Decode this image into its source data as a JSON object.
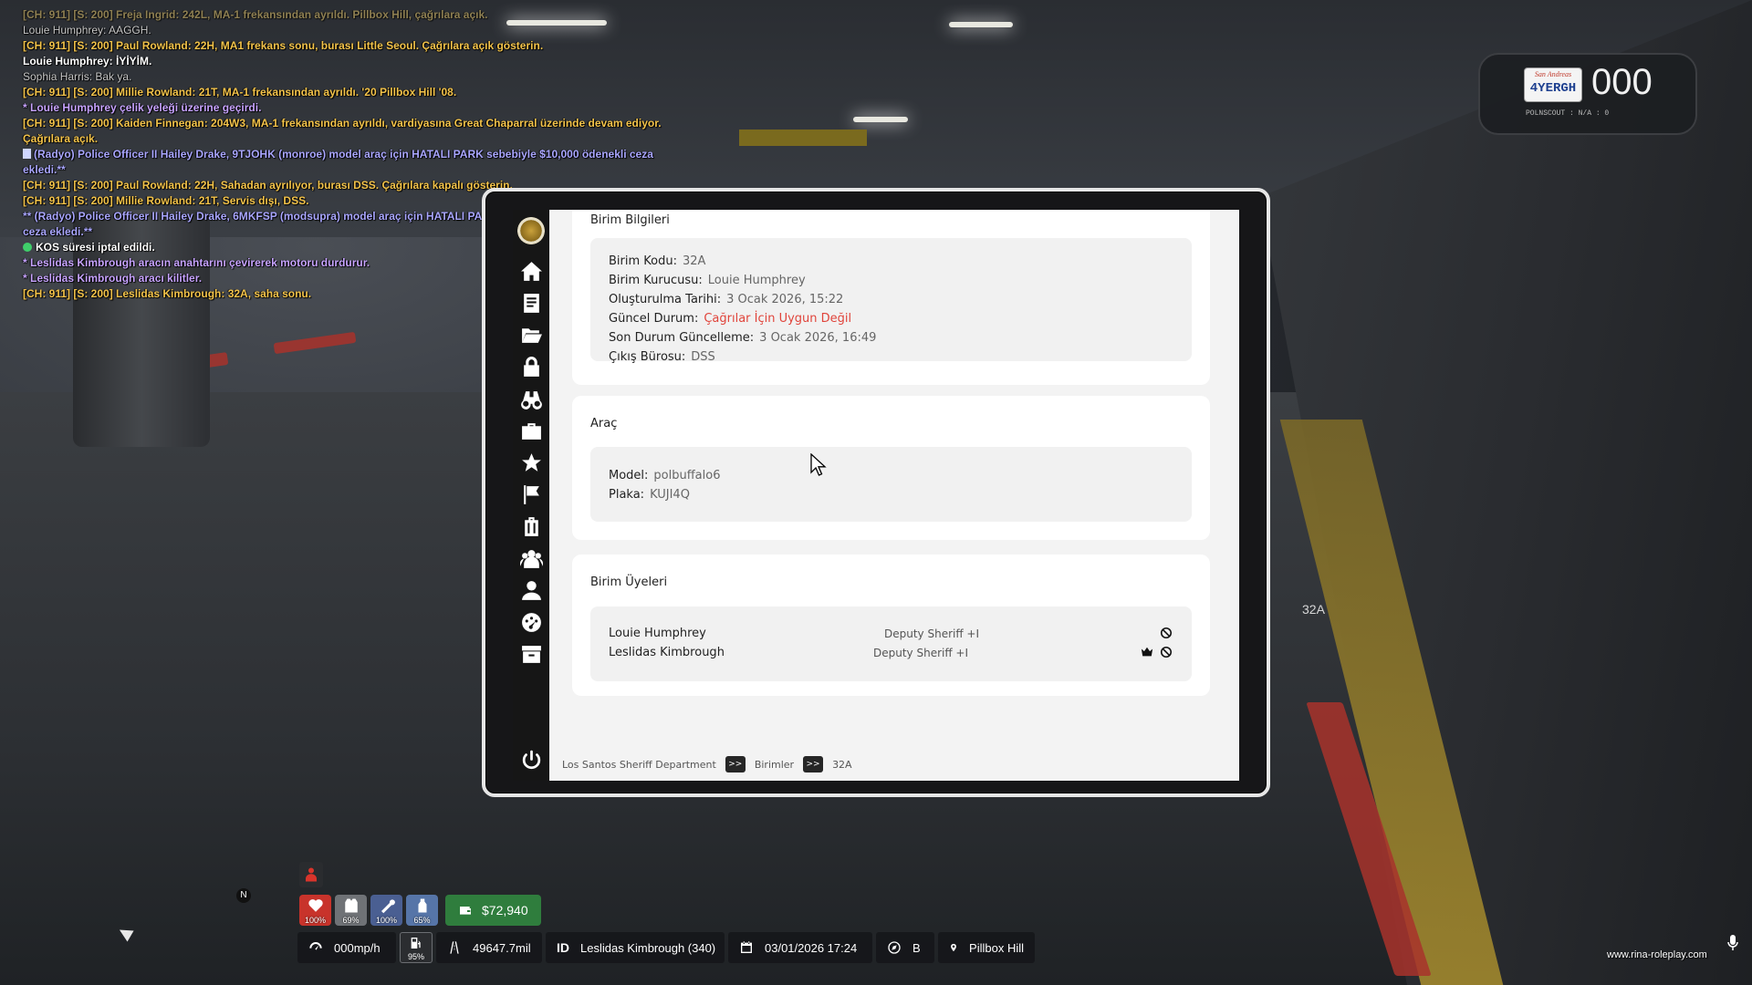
{
  "chat": [
    {
      "text": "[CH: 911] [S: 200] Freja Ingrid: 242L, MA-1 frekansından ayrıldı. Pillbox Hill, çağrılara açık.",
      "color": "fade"
    },
    {
      "text": "Louie Humphrey: AAGGH.",
      "color": "grey"
    },
    {
      "text": "[CH: 911] [S: 200] Paul Rowland: 22H, MA1 frekans sonu, burası Little Seoul. Çağrılara açık gösterin.",
      "color": "yellow"
    },
    {
      "text": "Louie Humphrey: İYİYİM.",
      "color": "white"
    },
    {
      "text": "Sophia Harris: Bak ya.",
      "color": "grey"
    },
    {
      "text": "[CH: 911] [S: 200] Millie Rowland: 21T, MA-1 frekansından ayrıldı. '20 Pillbox Hill '08.",
      "color": "yellow"
    },
    {
      "text": "* Louie Humphrey çelik yeleği üzerine geçirdi.",
      "color": "purple"
    },
    {
      "text": "[CH: 911] [S: 200] Kaiden Finnegan: 204W3, MA-1 frekansından ayrıldı, vardiyasına Great Chaparral üzerinde devam ediyor. Çağrılara açık.",
      "color": "yellow"
    },
    {
      "text": "(Radyo) Police Officer II Hailey Drake, 9TJOHK (monroe) model araç için HATALI PARK sebebiyle $10,000 ödenekli ceza ekledi.**",
      "color": "radio",
      "doc": true
    },
    {
      "text": "[CH: 911] [S: 200] Paul Rowland: 22H, Sahadan ayrılıyor, burası DSS. Çağrılara kapalı gösterin.",
      "color": "yellow"
    },
    {
      "text": "[CH: 911] [S: 200] Millie Rowland: 21T, Servis dışı, DSS.",
      "color": "yellow"
    },
    {
      "text": "** (Radyo) Police Officer II Hailey Drake, 6MKFSP (modsupra) model araç için HATALI PARK sebebiyle $10,000 ödenekli ceza ekledi.**",
      "color": "radio"
    },
    {
      "text": "KOS süresi iptal edildi.",
      "color": "white",
      "dot": true
    },
    {
      "text": "* Leslidas Kimbrough aracın anahtarını çevirerek motoru durdurur.",
      "color": "purple"
    },
    {
      "text": "* Leslidas Kimbrough aracı kilitler.",
      "color": "purple"
    },
    {
      "text": "[CH: 911] [S: 200] Leslidas Kimbrough: 32A, saha sonu.",
      "color": "yellow"
    }
  ],
  "plate": {
    "state": "San Andreas",
    "number": "4YERGH",
    "speed": "000",
    "sub": "POLNSCOUT : N/A : 0"
  },
  "unit_info": {
    "title": "Birim Bilgileri",
    "fields": [
      {
        "label": "Birim Kodu:",
        "value": "32A"
      },
      {
        "label": "Birim Kurucusu:",
        "value": "Louie Humphrey"
      },
      {
        "label": "Oluşturulma Tarihi:",
        "value": "3 Ocak 2026, 15:22"
      },
      {
        "label": "Güncel Durum:",
        "value": "Çağrılar İçin Uygun Değil"
      },
      {
        "label": "Son Durum Güncelleme:",
        "value": "3 Ocak 2026, 16:49"
      },
      {
        "label": "Çıkış Bürosu:",
        "value": "DSS"
      }
    ]
  },
  "vehicle": {
    "title": "Araç",
    "fields": [
      {
        "label": "Model:",
        "value": "polbuffalo6"
      },
      {
        "label": "Plaka:",
        "value": "KUJI4Q"
      }
    ]
  },
  "members": {
    "title": "Birim Üyeleri",
    "list": [
      {
        "name": "Louie Humphrey",
        "rank": "Deputy Sheriff +I"
      },
      {
        "name": "Leslidas Kimbrough",
        "rank": "Deputy Sheriff +I"
      }
    ]
  },
  "breadcrumb": {
    "root": "Los Santos Sheriff Department",
    "sep": ">>",
    "section": "Birimler",
    "current": "32A"
  },
  "hud": {
    "health": "100%",
    "armor": "69%",
    "hunger": "100%",
    "thirst": "65%",
    "money": "$72,940",
    "speed": "000mp/h",
    "fuel": "95%",
    "distance": "49647.7mil",
    "id_label": "ID",
    "player": "Leslidas Kimbrough (340)",
    "datetime": "03/01/2026 17:24",
    "heading": "B",
    "location": "Pillbox Hill",
    "compass": "N",
    "website": "www.rina-roleplay.com"
  },
  "car_label": "32A",
  "colors": {
    "status_red": "#e0443b",
    "money_green": "#2f7d3d",
    "health_red": "#c8332b",
    "armor_grey": "#6f7276",
    "hunger_blue": "#4a5f92",
    "thirst_blue": "#5675a8"
  }
}
